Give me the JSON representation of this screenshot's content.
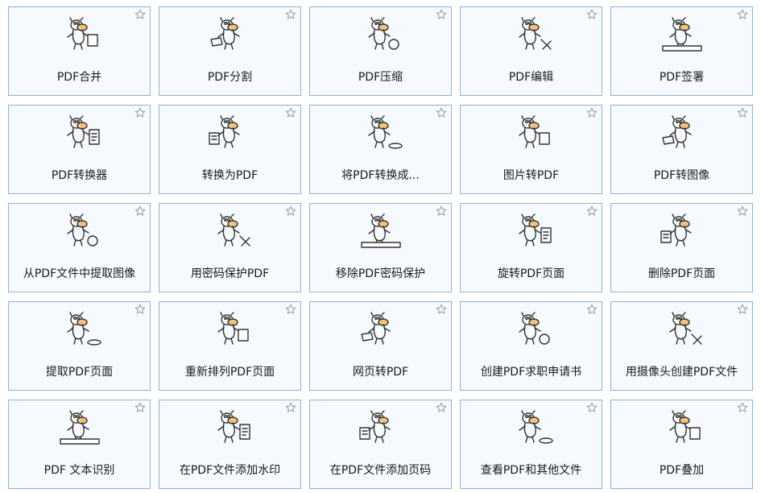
{
  "tools": [
    {
      "label": "PDF合并",
      "icon": "merge-pdf-icon",
      "starred": false
    },
    {
      "label": "PDF分割",
      "icon": "split-pdf-icon",
      "starred": false
    },
    {
      "label": "PDF压缩",
      "icon": "compress-pdf-icon",
      "starred": false
    },
    {
      "label": "PDF编辑",
      "icon": "edit-pdf-icon",
      "starred": false
    },
    {
      "label": "PDF签署",
      "icon": "sign-pdf-icon",
      "starred": false
    },
    {
      "label": "PDF转换器",
      "icon": "pdf-converter-icon",
      "starred": false
    },
    {
      "label": "转换为PDF",
      "icon": "convert-to-pdf-icon",
      "starred": false
    },
    {
      "label": "将PDF转换成...",
      "icon": "convert-pdf-to-icon",
      "starred": false
    },
    {
      "label": "图片转PDF",
      "icon": "image-to-pdf-icon",
      "starred": false
    },
    {
      "label": "PDF转图像",
      "icon": "pdf-to-image-icon",
      "starred": false
    },
    {
      "label": "从PDF文件中提取图像",
      "icon": "extract-images-icon",
      "starred": false
    },
    {
      "label": "用密码保护PDF",
      "icon": "password-protect-icon",
      "starred": false
    },
    {
      "label": "移除PDF密码保护",
      "icon": "remove-password-icon",
      "starred": false
    },
    {
      "label": "旋转PDF页面",
      "icon": "rotate-pages-icon",
      "starred": false
    },
    {
      "label": "删除PDF页面",
      "icon": "delete-pages-icon",
      "starred": false
    },
    {
      "label": "提取PDF页面",
      "icon": "extract-pages-icon",
      "starred": false
    },
    {
      "label": "重新排列PDF页面",
      "icon": "reorder-pages-icon",
      "starred": false
    },
    {
      "label": "网页转PDF",
      "icon": "webpage-to-pdf-icon",
      "starred": false
    },
    {
      "label": "创建PDF求职申请书",
      "icon": "job-application-icon",
      "starred": false
    },
    {
      "label": "用摄像头创建PDF文件",
      "icon": "webcam-pdf-icon",
      "starred": false
    },
    {
      "label": "PDF 文本识别",
      "icon": "ocr-icon",
      "starred": false
    },
    {
      "label": "在PDF文件添加水印",
      "icon": "watermark-icon",
      "starred": false
    },
    {
      "label": "在PDF文件添加页码",
      "icon": "page-numbers-icon",
      "starred": false
    },
    {
      "label": "查看PDF和其他文件",
      "icon": "view-files-icon",
      "starred": false
    },
    {
      "label": "PDF叠加",
      "icon": "overlay-pdf-icon",
      "starred": false
    }
  ],
  "colors": {
    "tile_bg": "#f6f9fd",
    "tile_border": "#8fb3d6",
    "star": "#9a9a9a",
    "sketch": "#333333",
    "accent": "#f2c27a"
  }
}
